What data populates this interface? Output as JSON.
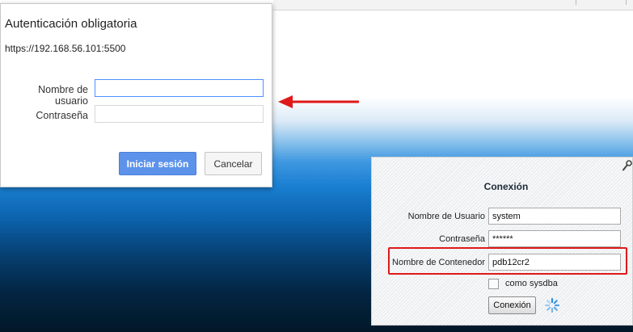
{
  "auth_dialog": {
    "title": "Autenticación obligatoria",
    "url": "https://192.168.56.101:5500",
    "username_label": "Nombre de usuario",
    "username_value": "",
    "password_label": "Contraseña",
    "password_value": "",
    "login_button": "Iniciar sesión",
    "cancel_button": "Cancelar"
  },
  "login_panel": {
    "title": "Conexión",
    "username_label": "Nombre de Usuario",
    "username_value": "system",
    "password_label": "Contraseña",
    "password_value": "******",
    "container_label": "Nombre de Contenedor",
    "container_value": "pdb12cr2",
    "sysdba_label": "como sysdba",
    "sysdba_checked": false,
    "connect_button": "Conexión"
  },
  "icons": {
    "arrow": "red-arrow-left",
    "spinner": "loading-spinner",
    "wrench": "wrench-icon"
  },
  "colors": {
    "primary_button": "#5c92ea",
    "focus_border": "#4d90fe",
    "annotation_red": "#e01919"
  }
}
